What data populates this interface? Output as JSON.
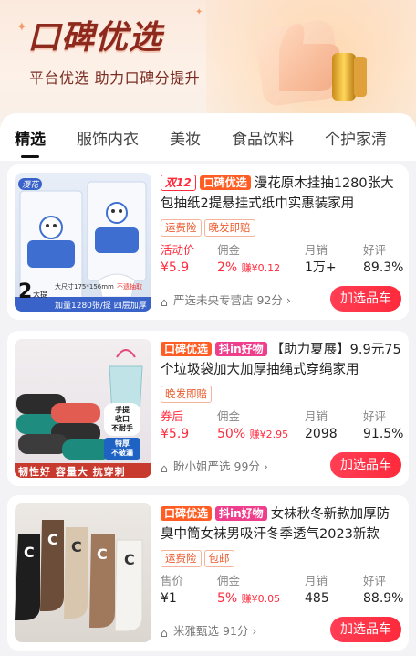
{
  "banner": {
    "title": "口碑优选",
    "subtitle": "平台优选 助力口碑分提升"
  },
  "tabs": [
    {
      "label": "精选",
      "active": true
    },
    {
      "label": "服饰内衣",
      "active": false
    },
    {
      "label": "美妆",
      "active": false
    },
    {
      "label": "食品饮料",
      "active": false
    },
    {
      "label": "个护家清",
      "active": false
    }
  ],
  "stat_labels": {
    "commission": "佣金",
    "monthly_sales": "月销",
    "rating": "好评"
  },
  "products": [
    {
      "tags": [
        "双12",
        "口碑优选"
      ],
      "title": "漫花原木挂抽1280张大包抽纸2提悬挂式纸巾实惠装家用",
      "badges": [
        "运费险",
        "晚发即赔"
      ],
      "price_label": "活动价",
      "price": "¥5.9",
      "commission_rate": "2%",
      "commission_amount": "赚¥0.12",
      "monthly_sales": "1万+",
      "rating": "89.3%",
      "store": "严选未央专营店",
      "store_score": "92分",
      "button": "加选品车",
      "image_text": {
        "brand": "漫花",
        "count_big": "2",
        "count_unit": "大提",
        "size_note": "大尺寸175*156mm",
        "spec": "不遗抽取",
        "bottom": "加量1280张/提  四层加厚"
      }
    },
    {
      "tags": [
        "口碑优选",
        "抖in好物"
      ],
      "title": "【助力夏展】9.9元75个垃圾袋加大加厚抽绳式穿绳家用",
      "badges": [
        "晚发即赔"
      ],
      "price_label": "券后",
      "price": "¥5.9",
      "commission_rate": "50%",
      "commission_amount": "赚¥2.95",
      "monthly_sales": "2098",
      "rating": "91.5%",
      "store": "盼小姐严选",
      "store_score": "99分",
      "button": "加选品车",
      "image_text": {
        "sticker1": "手提\n收口\n不耐手",
        "sticker2": "特厚\n不破漏",
        "bottom": "韧性好 容量大 抗穿刺"
      }
    },
    {
      "tags": [
        "口碑优选",
        "抖in好物"
      ],
      "title": "女袜秋冬新款加厚防臭中筒女袜男吸汗冬季透气2023新款",
      "badges": [
        "运费险",
        "包邮"
      ],
      "price_label": "售价",
      "price": "¥1",
      "commission_rate": "5%",
      "commission_amount": "赚¥0.05",
      "monthly_sales": "485",
      "rating": "88.9%",
      "store": "米雅甄选",
      "store_score": "91分",
      "button": "加选品车",
      "image_text": {
        "letter": "C"
      }
    }
  ],
  "colors": {
    "accent_red": "#ff2a3c",
    "koubei_tag": "#ff5d24",
    "douyin_tag": "#ee3e8c",
    "banner_title": "#8e2a1d"
  }
}
